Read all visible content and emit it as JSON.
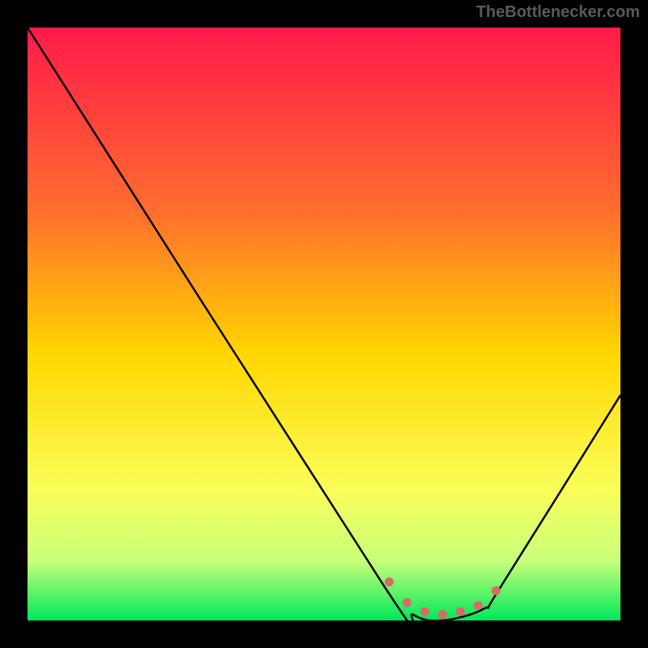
{
  "watermark": "TheBottlenecker.com",
  "chart_data": {
    "type": "line",
    "title": "",
    "xlabel": "",
    "ylabel": "",
    "xlim": [
      0,
      100
    ],
    "ylim": [
      0,
      100
    ],
    "background": {
      "type": "vertical_gradient",
      "stops": [
        {
          "offset": 0,
          "color": "#ff1a4a"
        },
        {
          "offset": 30,
          "color": "#ff6a2f"
        },
        {
          "offset": 55,
          "color": "#ffd600"
        },
        {
          "offset": 78,
          "color": "#faff5a"
        },
        {
          "offset": 90,
          "color": "#c8ff7a"
        },
        {
          "offset": 100,
          "color": "#00e85a"
        }
      ]
    },
    "series": [
      {
        "name": "bottleneck-curve",
        "color": "#000000",
        "points": [
          {
            "x": 0,
            "y": 100
          },
          {
            "x": 60,
            "y": 6
          },
          {
            "x": 65,
            "y": 1
          },
          {
            "x": 70,
            "y": 0
          },
          {
            "x": 77,
            "y": 2
          },
          {
            "x": 80,
            "y": 6
          },
          {
            "x": 100,
            "y": 38
          }
        ]
      }
    ],
    "markers": [
      {
        "x": 61,
        "y": 6.5,
        "color": "#d96a6a"
      },
      {
        "x": 64,
        "y": 3,
        "color": "#d96a6a"
      },
      {
        "x": 67,
        "y": 1.5,
        "color": "#d96a6a"
      },
      {
        "x": 70,
        "y": 1,
        "color": "#d96a6a"
      },
      {
        "x": 73,
        "y": 1.5,
        "color": "#d96a6a"
      },
      {
        "x": 76,
        "y": 2.5,
        "color": "#d96a6a"
      },
      {
        "x": 79,
        "y": 5,
        "color": "#d96a6a"
      }
    ]
  }
}
